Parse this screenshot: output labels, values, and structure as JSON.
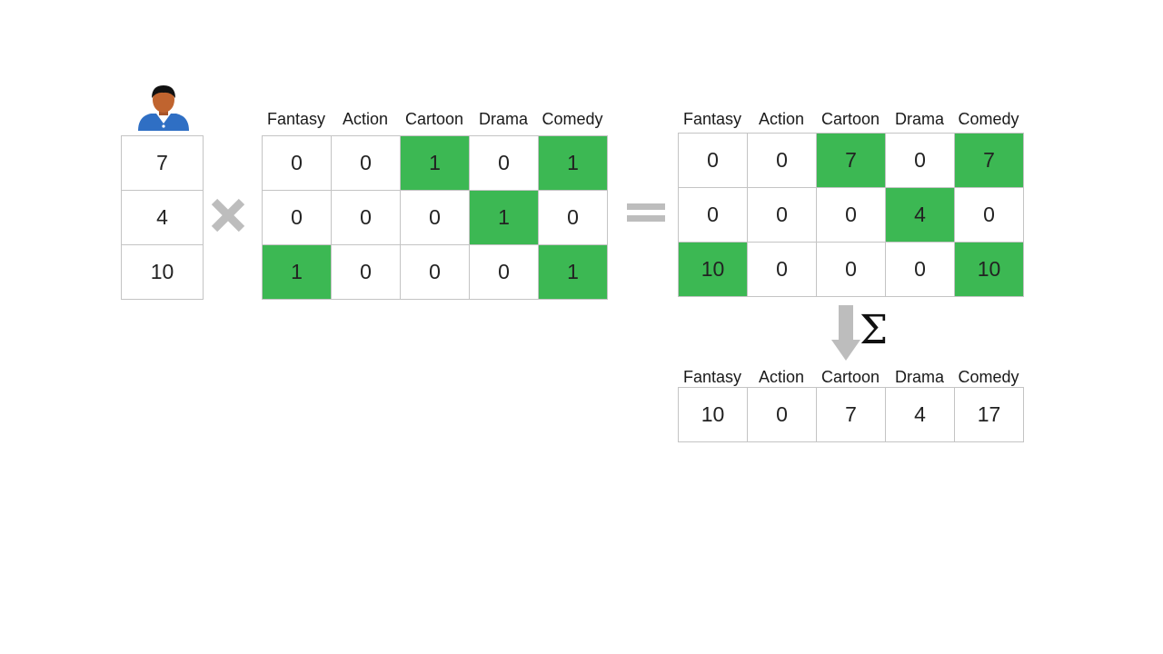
{
  "colors": {
    "highlight": "#3cb853",
    "border": "#c4c4c4",
    "operator": "#bdbdbd"
  },
  "icons": {
    "user": "person-avatar-icon",
    "multiply": "multiply-icon",
    "equals": "equals-icon",
    "arrow": "down-arrow-icon"
  },
  "user_ratings": [
    "7",
    "4",
    "10"
  ],
  "genre_matrix": {
    "headers": [
      "Fantasy",
      "Action",
      "Cartoon",
      "Drama",
      "Comedy"
    ],
    "rows": [
      [
        "0",
        "0",
        "1",
        "0",
        "1"
      ],
      [
        "0",
        "0",
        "0",
        "1",
        "0"
      ],
      [
        "1",
        "0",
        "0",
        "0",
        "1"
      ]
    ]
  },
  "weighted_matrix": {
    "headers": [
      "Fantasy",
      "Action",
      "Cartoon",
      "Drama",
      "Comedy"
    ],
    "rows": [
      [
        "0",
        "0",
        "7",
        "0",
        "7"
      ],
      [
        "0",
        "0",
        "0",
        "4",
        "0"
      ],
      [
        "10",
        "0",
        "0",
        "0",
        "10"
      ]
    ]
  },
  "sum_symbol": "Σ",
  "user_profile": {
    "headers": [
      "Fantasy",
      "Action",
      "Cartoon",
      "Drama",
      "Comedy"
    ],
    "values": [
      "10",
      "0",
      "7",
      "4",
      "17"
    ]
  }
}
